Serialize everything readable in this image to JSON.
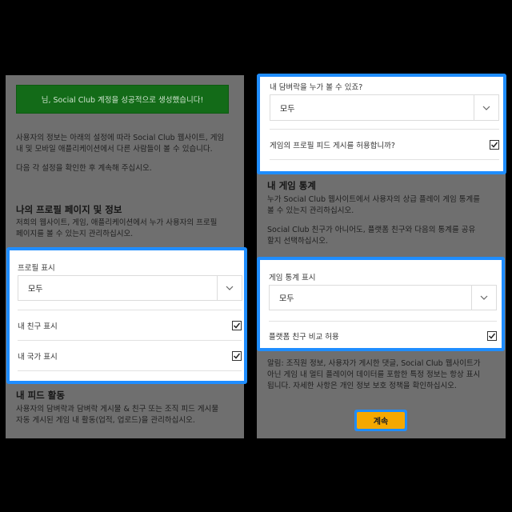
{
  "left": {
    "banner": "님, Social Club 계정을 성공적으로 생성했습니다!",
    "intro1a": "사용자의 정보는 아래의 설정에 따라 Social Club 웹사이트, 게임",
    "intro1b": "내 및 모바일 애플리케이션에서 다른 사람들이 볼 수 있습니다.",
    "intro2": "다음 각 설정을 확인한 후 계속해 주십시오.",
    "profile_heading": "나의 프로필 페이지 및 정보",
    "profile_desc_a": "저희의 웹사이트, 게임, 애플리케이션에서 누가 사용자의 프로필",
    "profile_desc_b": "페이지를 볼 수 있는지 관리하십시오.",
    "profile_display_label": "프로필 표시",
    "profile_display_value": "모두",
    "show_friends_label": "내 친구 표시",
    "show_country_label": "내 국가 표시",
    "feed_heading": "내 피드 활동",
    "feed_desc_a": "사용자의 담벼락과 담벼락 게시물 & 친구 또는 조직 피드 게시물",
    "feed_desc_b": "자동 게시된 게임 내 활동(업적, 업로드)을 관리하십시오."
  },
  "right": {
    "wall_question": "내 담벼락을 누가 볼 수 있죠?",
    "wall_value": "모두",
    "allow_feed_label": "게임의 프로필 피드 게시를 허용합니까?",
    "stats_heading": "내 게임 통계",
    "stats_desc_a": "누가 Social Club 웹사이트에서 사용자의 상급 플레이 게임 통계를",
    "stats_desc_b": "볼 수 있는지 관리하십시오.",
    "stats_desc_c": "Social Club 친구가 아니어도, 플랫폼 친구와 다음의 통계를 공유",
    "stats_desc_d": "할지 선택하십시오.",
    "stats_display_label": "게임 통계 표시",
    "stats_display_value": "모두",
    "platform_compare_label": "플랫폼 친구 비교 허용",
    "notice_a": "알림: 조직원 정보, 사용자가 게시한 댓글, Social Club 웹사이트가",
    "notice_b": "아닌 게임 내 멀티 플레이어 데이터를 포함한 특정 정보는 항상 표시",
    "notice_c": "됩니다. 자세한 사항은 개인 정보 보호 정책을 확인하십시오.",
    "continue_label": "계속"
  },
  "colors": {
    "highlight": "#1f8dff",
    "banner": "#136b18",
    "button": "#f5a800"
  }
}
